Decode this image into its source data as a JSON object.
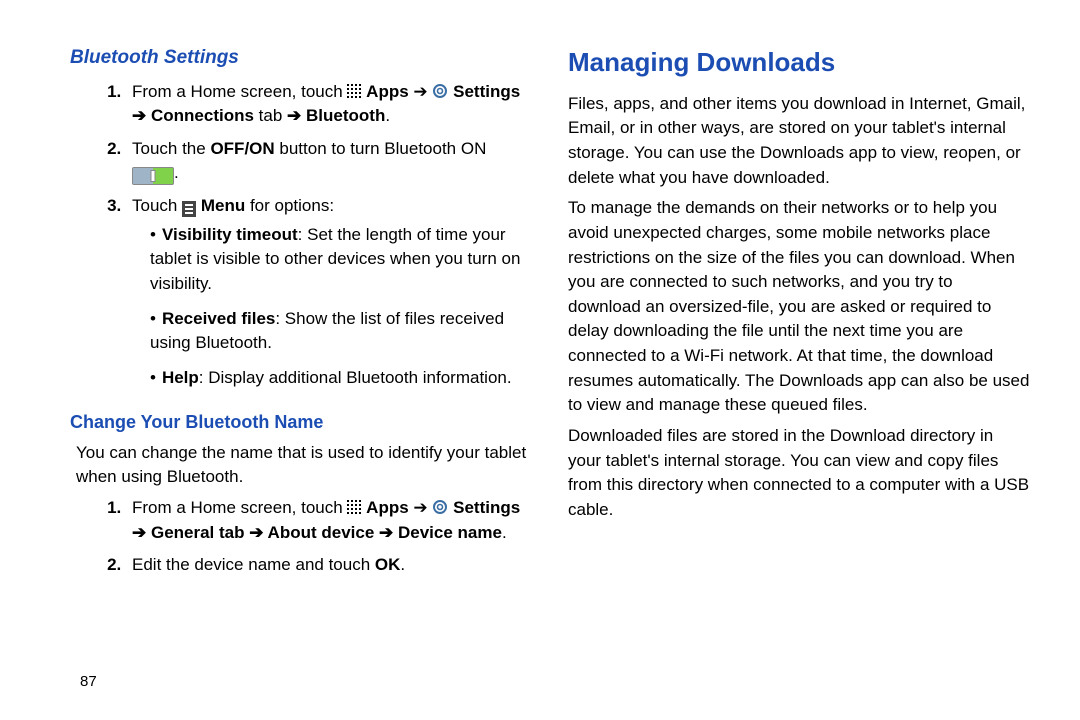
{
  "page_number": "87",
  "left": {
    "h1": "Bluetooth Settings",
    "steps_a": {
      "s1_prefix": "From a Home screen, touch",
      "s1_apps": "Apps",
      "s1_arrow": "➔",
      "s1_settings": "Settings",
      "s1_line2_arrow": "➔",
      "s1_connections": "Connections",
      "s1_tab": " tab ",
      "s1_bluetooth": "Bluetooth",
      "s2_a": "Touch the ",
      "s2_offon": "OFF/ON",
      "s2_b": " button to turn Bluetooth ON ",
      "s3_a": "Touch ",
      "s3_menu": "Menu",
      "s3_b": " for options:"
    },
    "bullets": {
      "b1_label": "Visibility timeout",
      "b1_rest": ": Set the length of time your tablet is visible to other devices when you turn on visibility.",
      "b2_label": "Received files",
      "b2_rest": ": Show the list of files received using Bluetooth.",
      "b3_label": "Help",
      "b3_rest": ": Display additional Bluetooth information."
    },
    "h2": "Change Your Bluetooth Name",
    "p2": "You can change the name that is used to identify your tablet when using Bluetooth.",
    "steps_b": {
      "s1_prefix": "From a Home screen, touch",
      "s1_apps": "Apps",
      "s1_arrow": "➔",
      "s1_settings": "Settings",
      "s1_line2": "➔ General tab ➔ About device ➔ Device name",
      "s2_a": "Edit the device name and touch ",
      "s2_ok": "OK"
    }
  },
  "right": {
    "h1": "Managing Downloads",
    "p1": "Files, apps, and other items you download in Internet, Gmail, Email, or in other ways, are stored on your tablet's internal storage. You can use the Downloads app to view, reopen, or delete what you have downloaded.",
    "p2": "To manage the demands on their networks or to help you avoid unexpected charges, some mobile networks place restrictions on the size of the files you can download. When you are connected to such networks, and you try to download an oversized-file, you are asked or required to delay downloading the file until the next time you are connected to a Wi-Fi network. At that time, the download resumes automatically. The Downloads app can also be used to view and manage these queued files.",
    "p3": "Downloaded files are stored in the Download directory in your tablet's internal storage. You can view and copy files from this directory when connected to a computer with a USB cable."
  }
}
